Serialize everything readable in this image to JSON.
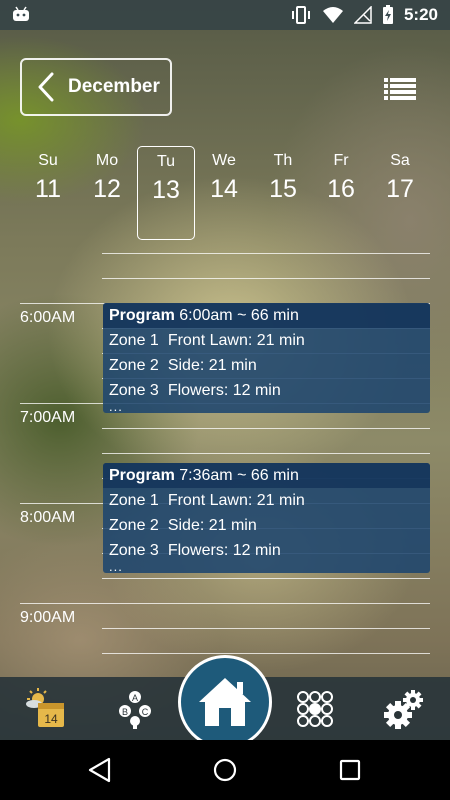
{
  "status_bar": {
    "time": "5:20",
    "icons": [
      "android-icon",
      "vibrate-icon",
      "wifi-icon",
      "no-signal-icon",
      "battery-charging-icon"
    ]
  },
  "header": {
    "month_label": "December",
    "back_icon": "chevron-left-icon",
    "list_icon": "list-view-icon"
  },
  "week": {
    "days": [
      {
        "name": "Su",
        "date": "11",
        "selected": false
      },
      {
        "name": "Mo",
        "date": "12",
        "selected": false
      },
      {
        "name": "Tu",
        "date": "13",
        "selected": true
      },
      {
        "name": "We",
        "date": "14",
        "selected": false
      },
      {
        "name": "Th",
        "date": "15",
        "selected": false
      },
      {
        "name": "Fr",
        "date": "16",
        "selected": false
      },
      {
        "name": "Sa",
        "date": "17",
        "selected": false
      }
    ]
  },
  "timeline": {
    "hours": [
      "6:00AM",
      "7:00AM",
      "8:00AM",
      "9:00AM"
    ],
    "events": [
      {
        "title": "Program",
        "detail": "6:00am ~ 66 min",
        "zones": [
          {
            "num": "Zone 1",
            "name": "Front Lawn: 21 min"
          },
          {
            "num": "Zone 2",
            "name": "Side: 21 min"
          },
          {
            "num": "Zone 3",
            "name": "Flowers: 12 min"
          }
        ],
        "more": "..."
      },
      {
        "title": "Program",
        "detail": "7:36am ~ 66 min",
        "zones": [
          {
            "num": "Zone 1",
            "name": "Front Lawn: 21 min"
          },
          {
            "num": "Zone 2",
            "name": "Side: 21 min"
          },
          {
            "num": "Zone 3",
            "name": "Flowers: 12 min"
          }
        ],
        "more": "..."
      }
    ]
  },
  "bottom_nav": {
    "calendar_badge": "14",
    "items": [
      "calendar-weather-icon",
      "controller-abc-icon",
      "home-icon",
      "zones-grid-icon",
      "settings-gears-icon"
    ],
    "accent": "#1e5a7a"
  },
  "system_nav": [
    "back-triangle-icon",
    "home-circle-icon",
    "recents-square-icon"
  ]
}
